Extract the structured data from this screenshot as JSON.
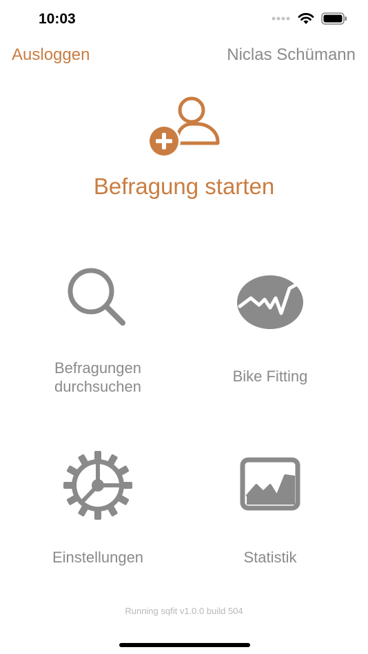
{
  "status_bar": {
    "time": "10:03"
  },
  "nav": {
    "logout_label": "Ausloggen",
    "user_name": "Niclas Schümann"
  },
  "start": {
    "label": "Befragung starten",
    "icon": "add-user-icon"
  },
  "tiles": [
    {
      "label_line1": "Befragungen",
      "label_line2": "durchsuchen",
      "icon": "search-icon"
    },
    {
      "label_line1": "Bike Fitting",
      "icon": "bike-fitting-icon"
    },
    {
      "label_line1": "Einstellungen",
      "icon": "gear-icon"
    },
    {
      "label_line1": "Statistik",
      "icon": "statistics-icon"
    }
  ],
  "footer": {
    "version": "Running sqfit v1.0.0 build 504"
  },
  "colors": {
    "accent": "#c97d42",
    "gray": "#8a8a8a"
  }
}
